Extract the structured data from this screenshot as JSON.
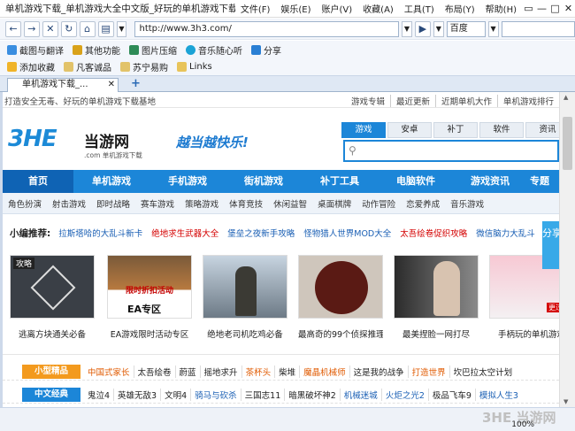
{
  "window": {
    "title": "单机游戏下载_单机游戏大全中文版_好玩的单机游戏下载基地",
    "menu": [
      "文件(F)",
      "娱乐(E)",
      "账户(V)",
      "收藏(A)",
      "工具(T)",
      "布局(Y)",
      "帮助(H)"
    ],
    "controls": [
      "▭",
      "—",
      "□",
      "✕"
    ]
  },
  "navbar": {
    "url": "http://www.3h3.com/",
    "search_engine": "百度",
    "search_placeholder": ""
  },
  "toolbar": {
    "items": [
      "截图与翻译",
      "其他功能",
      "图片压缩",
      "音乐随心听",
      "分享"
    ]
  },
  "favorites": {
    "items": [
      "添加收藏",
      "凡客诚品",
      "苏宁易购",
      "Links"
    ]
  },
  "tabs": [
    {
      "label": "单机游戏下载_..."
    }
  ],
  "page": {
    "slogan": "打造安全无毒、好玩的单机游戏下载基地",
    "top_links": [
      "游戏专辑",
      "最近更新",
      "近期单机大作",
      "单机游戏排行"
    ],
    "logo_big": "3HE",
    "logo_name": "当游网",
    "logo_sub": ".com 单机游戏下载",
    "tagline": "越当越快乐!",
    "search_tabs": [
      "游戏",
      "安卓",
      "补丁",
      "软件",
      "资讯"
    ],
    "main_nav": [
      "首页",
      "单机游戏",
      "手机游戏",
      "街机游戏",
      "补丁工具",
      "电脑软件",
      "游戏资讯",
      "专题"
    ],
    "sub_nav": [
      "角色扮演",
      "射击游戏",
      "即时战略",
      "赛车游戏",
      "策略游戏",
      "体育竞技",
      "休闲益智",
      "桌面棋牌",
      "动作冒险",
      "恋爱养成",
      "音乐游戏"
    ],
    "recommend_label": "小编推荐:",
    "recommend": [
      "拉斯塔哈的大乱斗新卡",
      "绝地求生武器大全",
      "堡垒之夜新手攻略",
      "怪物猎人世界MOD大全",
      "太吾绘卷促织攻略",
      "微信脑力大乱斗"
    ],
    "recommend_colors": [
      "#1a5fb4",
      "#d40000",
      "#1a5fb4",
      "#1a5fb4",
      "#d40000",
      "#1a5fb4"
    ],
    "cards": [
      {
        "caption": "逃离方块通关必备",
        "badge": "攻略"
      },
      {
        "caption": "EA游戏限时活动专区",
        "badge": "限时折扣活动",
        "sub": "EA专区"
      },
      {
        "caption": "绝地老司机吃鸡必备",
        "badge": ""
      },
      {
        "caption": "最高奇的99个侦探推理",
        "badge": ""
      },
      {
        "caption": "最美捏脸一网打尽",
        "badge": ""
      },
      {
        "caption": "手柄玩的单机游戏",
        "badge": "更过瘾"
      }
    ],
    "share_label": "分享",
    "rows": [
      {
        "label": "小型精品",
        "color": "#f39a1e",
        "items": [
          "中国式家长",
          "太吾绘卷",
          "蔚蓝",
          "摇地求升",
          "茶杯头",
          "柴堆",
          "魔晶机械师",
          "这是我的战争",
          "打造世界",
          "坎巴拉太空计划"
        ],
        "hot": [
          0,
          4,
          6,
          8
        ]
      },
      {
        "label": "中文经典",
        "color": "#1c86d8",
        "items": [
          "鬼泣4",
          "英雄无敌3",
          "文明4",
          "骑马与砍杀",
          "三国志11",
          "暗黑破坏神2",
          "机械迷城",
          "火炬之光2",
          "极品飞车9",
          "模拟人生3"
        ],
        "hot": [
          3,
          6,
          7,
          9
        ]
      }
    ]
  },
  "status": {
    "zoom": "100%",
    "watermark": "3HE 当游网"
  },
  "colors": {
    "accent": "#1c86d8",
    "hot": "#d40000"
  }
}
